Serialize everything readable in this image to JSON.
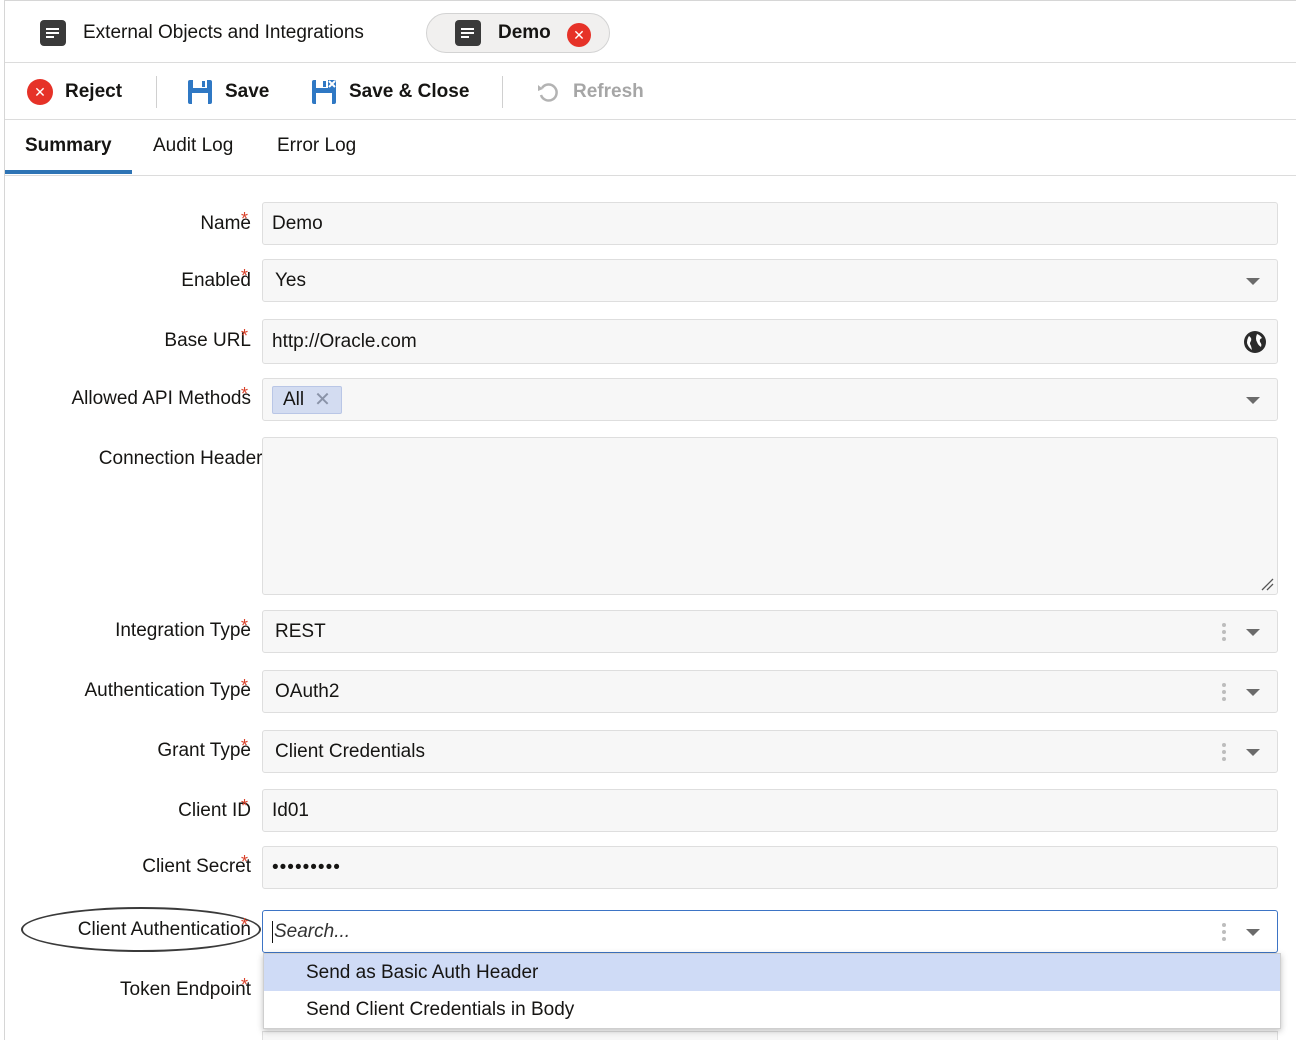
{
  "tabs": [
    {
      "label": "External Objects and Integrations"
    },
    {
      "label": "Demo"
    }
  ],
  "toolbar": {
    "reject": "Reject",
    "save": "Save",
    "save_close": "Save & Close",
    "refresh": "Refresh"
  },
  "subtabs": [
    "Summary",
    "Audit Log",
    "Error Log"
  ],
  "form": {
    "name": {
      "label": "Name",
      "value": "Demo"
    },
    "enabled": {
      "label": "Enabled",
      "value": "Yes"
    },
    "base_url": {
      "label": "Base URL",
      "value": "http://Oracle.com"
    },
    "allowed_methods": {
      "label": "Allowed API Methods",
      "chip": "All"
    },
    "connection_headers": {
      "label": "Connection Headers"
    },
    "integration_type": {
      "label": "Integration Type",
      "value": "REST"
    },
    "authentication_type": {
      "label": "Authentication Type",
      "value": "OAuth2"
    },
    "grant_type": {
      "label": "Grant Type",
      "value": "Client Credentials"
    },
    "client_id": {
      "label": "Client ID",
      "value": "Id01"
    },
    "client_secret": {
      "label": "Client Secret",
      "value": "•••••••••"
    },
    "client_authentication": {
      "label": "Client Authentication",
      "placeholder": "Search..."
    },
    "token_endpoint": {
      "label": "Token Endpoint"
    },
    "required_mark": "*"
  },
  "dropdown": {
    "options": [
      "Send as Basic Auth Header",
      "Send Client Credentials in Body"
    ]
  },
  "colors": {
    "accent": "#2e74b5",
    "danger": "#e63228",
    "highlight": "#cfdbf6"
  }
}
